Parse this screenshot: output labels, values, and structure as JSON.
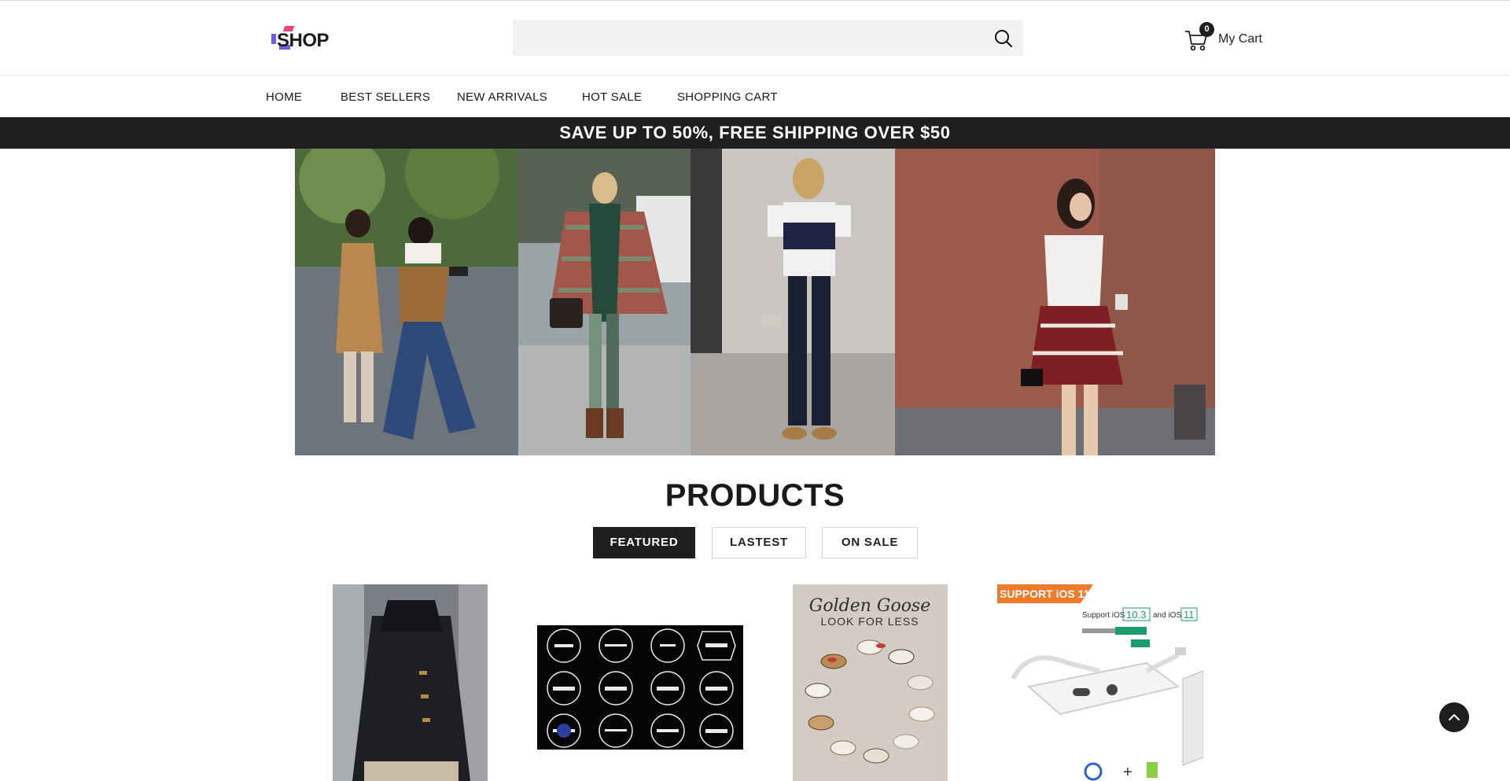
{
  "header": {
    "logo_text": "SHOP",
    "search": {
      "placeholder": "",
      "value": ""
    },
    "cart": {
      "count": "0",
      "label": "My Cart"
    }
  },
  "nav": {
    "items": [
      "HOME",
      "BEST SELLERS",
      "NEW ARRIVALS",
      "HOT SALE",
      "SHOPPING CART"
    ]
  },
  "promo": {
    "text": "SAVE UP TO 50%, FREE SHIPPING OVER $50"
  },
  "products": {
    "title": "PRODUCTS",
    "tabs": [
      "FEATURED",
      "LASTEST",
      "ON SALE"
    ],
    "active_tab": "FEATURED",
    "items": [
      {
        "image": "black duffle coat"
      },
      {
        "image": "logo sticker sheet"
      },
      {
        "image": "golden goose sneakers",
        "image_text": [
          "Golden Goose",
          "LOOK FOR LESS"
        ]
      },
      {
        "image": "lightning audio adapter",
        "badge": "SUPPORT iOS 11",
        "lines": [
          "Support iOS",
          "10.3",
          "and iOS",
          "11"
        ]
      }
    ]
  },
  "colors": {
    "dark": "#1f1f1f",
    "badge_orange": "#f07a2c",
    "accent_green": "#1a9e6b"
  }
}
